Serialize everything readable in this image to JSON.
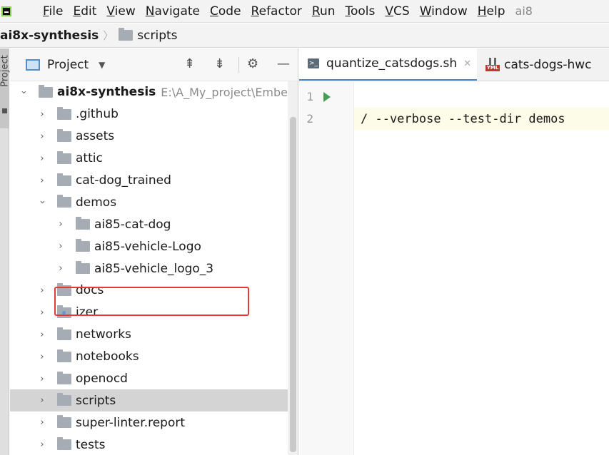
{
  "menu": {
    "items": [
      "File",
      "Edit",
      "View",
      "Navigate",
      "Code",
      "Refactor",
      "Run",
      "Tools",
      "VCS",
      "Window",
      "Help"
    ],
    "window_title_fragment": "ai8"
  },
  "breadcrumb": {
    "root": "ai8x-synthesis",
    "child": "scripts"
  },
  "side_strip": {
    "tab_label": "Project"
  },
  "project_panel": {
    "title": "Project",
    "tree": [
      {
        "label": "ai8x-synthesis",
        "path": "E:\\A_My_project\\Embe",
        "expanded": true,
        "bold": true
      },
      {
        "label": ".github"
      },
      {
        "label": "assets"
      },
      {
        "label": "attic"
      },
      {
        "label": "cat-dog_trained"
      },
      {
        "label": "demos",
        "expanded": true
      },
      {
        "label": "ai85-cat-dog"
      },
      {
        "label": "ai85-vehicle-Logo"
      },
      {
        "label": "ai85-vehicle_logo_3"
      },
      {
        "label": "docs"
      },
      {
        "label": "izer"
      },
      {
        "label": "networks"
      },
      {
        "label": "notebooks"
      },
      {
        "label": "openocd"
      },
      {
        "label": "scripts",
        "selected": true
      },
      {
        "label": "super-linter.report"
      },
      {
        "label": "tests"
      }
    ]
  },
  "editor": {
    "tabs": [
      {
        "label": "quantize_catsdogs.sh",
        "active": true
      },
      {
        "label": "cats-dogs-hwc"
      }
    ],
    "lines": [
      {
        "number": "1",
        "code": ""
      },
      {
        "number": "2",
        "code": "/ --verbose --test-dir demos"
      }
    ]
  },
  "colors": {
    "accent": "#4a86c7",
    "highlight_box": "#e53935",
    "selected_row": "#d4d4d4"
  }
}
